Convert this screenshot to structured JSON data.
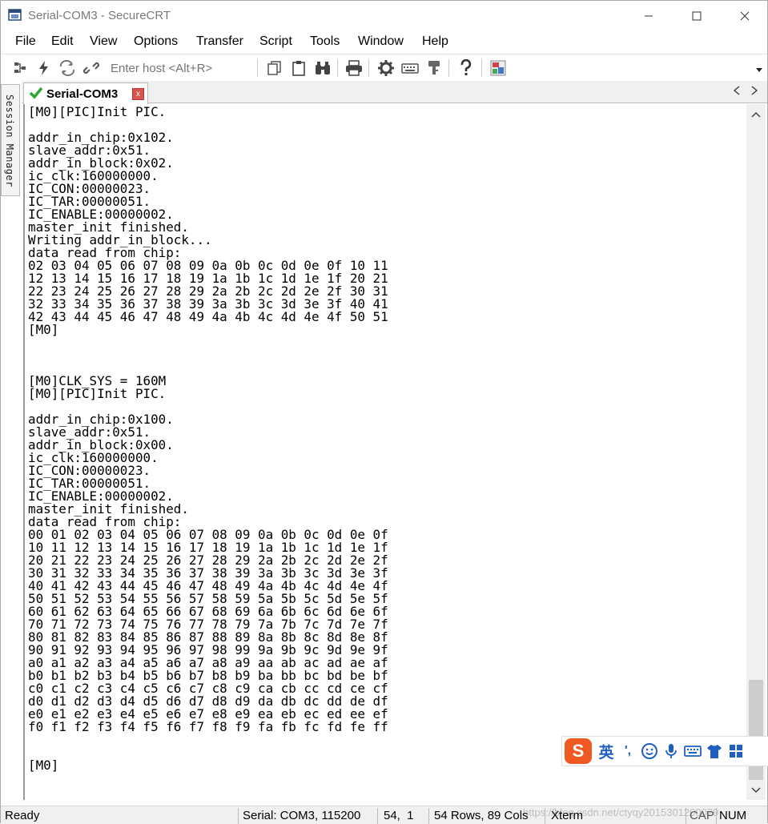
{
  "window": {
    "title": "Serial-COM3 - SecureCRT"
  },
  "menu": [
    "File",
    "Edit",
    "View",
    "Options",
    "Transfer",
    "Script",
    "Tools",
    "Window",
    "Help"
  ],
  "toolbar": {
    "host_placeholder": "Enter host <Alt+R>"
  },
  "sidebar": {
    "session_manager_label": "Session Manager"
  },
  "tab": {
    "label": "Serial-COM3",
    "close": "x"
  },
  "terminal": {
    "lines": [
      "[M0][PIC]Init PIC.",
      "",
      "addr_in_chip:0x102.",
      "slave_addr:0x51.",
      "addr_in_block:0x02.",
      "ic_clk:160000000.",
      "IC_CON:00000023.",
      "IC_TAR:00000051.",
      "IC_ENABLE:00000002.",
      "master_init finished.",
      "Writing addr_in_block...",
      "data read from chip:",
      "02 03 04 05 06 07 08 09 0a 0b 0c 0d 0e 0f 10 11",
      "12 13 14 15 16 17 18 19 1a 1b 1c 1d 1e 1f 20 21",
      "22 23 24 25 26 27 28 29 2a 2b 2c 2d 2e 2f 30 31",
      "32 33 34 35 36 37 38 39 3a 3b 3c 3d 3e 3f 40 41",
      "42 43 44 45 46 47 48 49 4a 4b 4c 4d 4e 4f 50 51",
      "[M0]",
      "",
      "",
      "",
      "[M0]CLK_SYS = 160M",
      "[M0][PIC]Init PIC.",
      "",
      "addr_in_chip:0x100.",
      "slave_addr:0x51.",
      "addr_in_block:0x00.",
      "ic_clk:160000000.",
      "IC_CON:00000023.",
      "IC_TAR:00000051.",
      "IC_ENABLE:00000002.",
      "master_init finished.",
      "data read from chip:",
      "00 01 02 03 04 05 06 07 08 09 0a 0b 0c 0d 0e 0f",
      "10 11 12 13 14 15 16 17 18 19 1a 1b 1c 1d 1e 1f",
      "20 21 22 23 24 25 26 27 28 29 2a 2b 2c 2d 2e 2f",
      "30 31 32 33 34 35 36 37 38 39 3a 3b 3c 3d 3e 3f",
      "40 41 42 43 44 45 46 47 48 49 4a 4b 4c 4d 4e 4f",
      "50 51 52 53 54 55 56 57 58 59 5a 5b 5c 5d 5e 5f",
      "60 61 62 63 64 65 66 67 68 69 6a 6b 6c 6d 6e 6f",
      "70 71 72 73 74 75 76 77 78 79 7a 7b 7c 7d 7e 7f",
      "80 81 82 83 84 85 86 87 88 89 8a 8b 8c 8d 8e 8f",
      "90 91 92 93 94 95 96 97 98 99 9a 9b 9c 9d 9e 9f",
      "a0 a1 a2 a3 a4 a5 a6 a7 a8 a9 aa ab ac ad ae af",
      "b0 b1 b2 b3 b4 b5 b6 b7 b8 b9 ba bb bc bd be bf",
      "c0 c1 c2 c3 c4 c5 c6 c7 c8 c9 ca cb cc cd ce cf",
      "d0 d1 d2 d3 d4 d5 d6 d7 d8 d9 da db dc dd de df",
      "e0 e1 e2 e3 e4 e5 e6 e7 e8 e9 ea eb ec ed ee ef",
      "f0 f1 f2 f3 f4 f5 f6 f7 f8 f9 fa fb fc fd fe ff",
      "",
      "",
      "[M0]"
    ]
  },
  "ime": {
    "logo": "S",
    "mode": "英",
    "punct": "',"
  },
  "status": {
    "ready": "Ready",
    "connection": "Serial: COM3, 115200",
    "cursor": "54,  1",
    "size": "54 Rows, 89 Cols",
    "emulation": "Xterm",
    "caps": "CAP",
    "num": "NUM",
    "watermark": "https://blog.csdn.net/ctyqy2015301200079"
  },
  "colors": {
    "accent_green": "#2aa832",
    "tab_close_red": "#d9534f",
    "ime_orange": "#f05a22"
  }
}
